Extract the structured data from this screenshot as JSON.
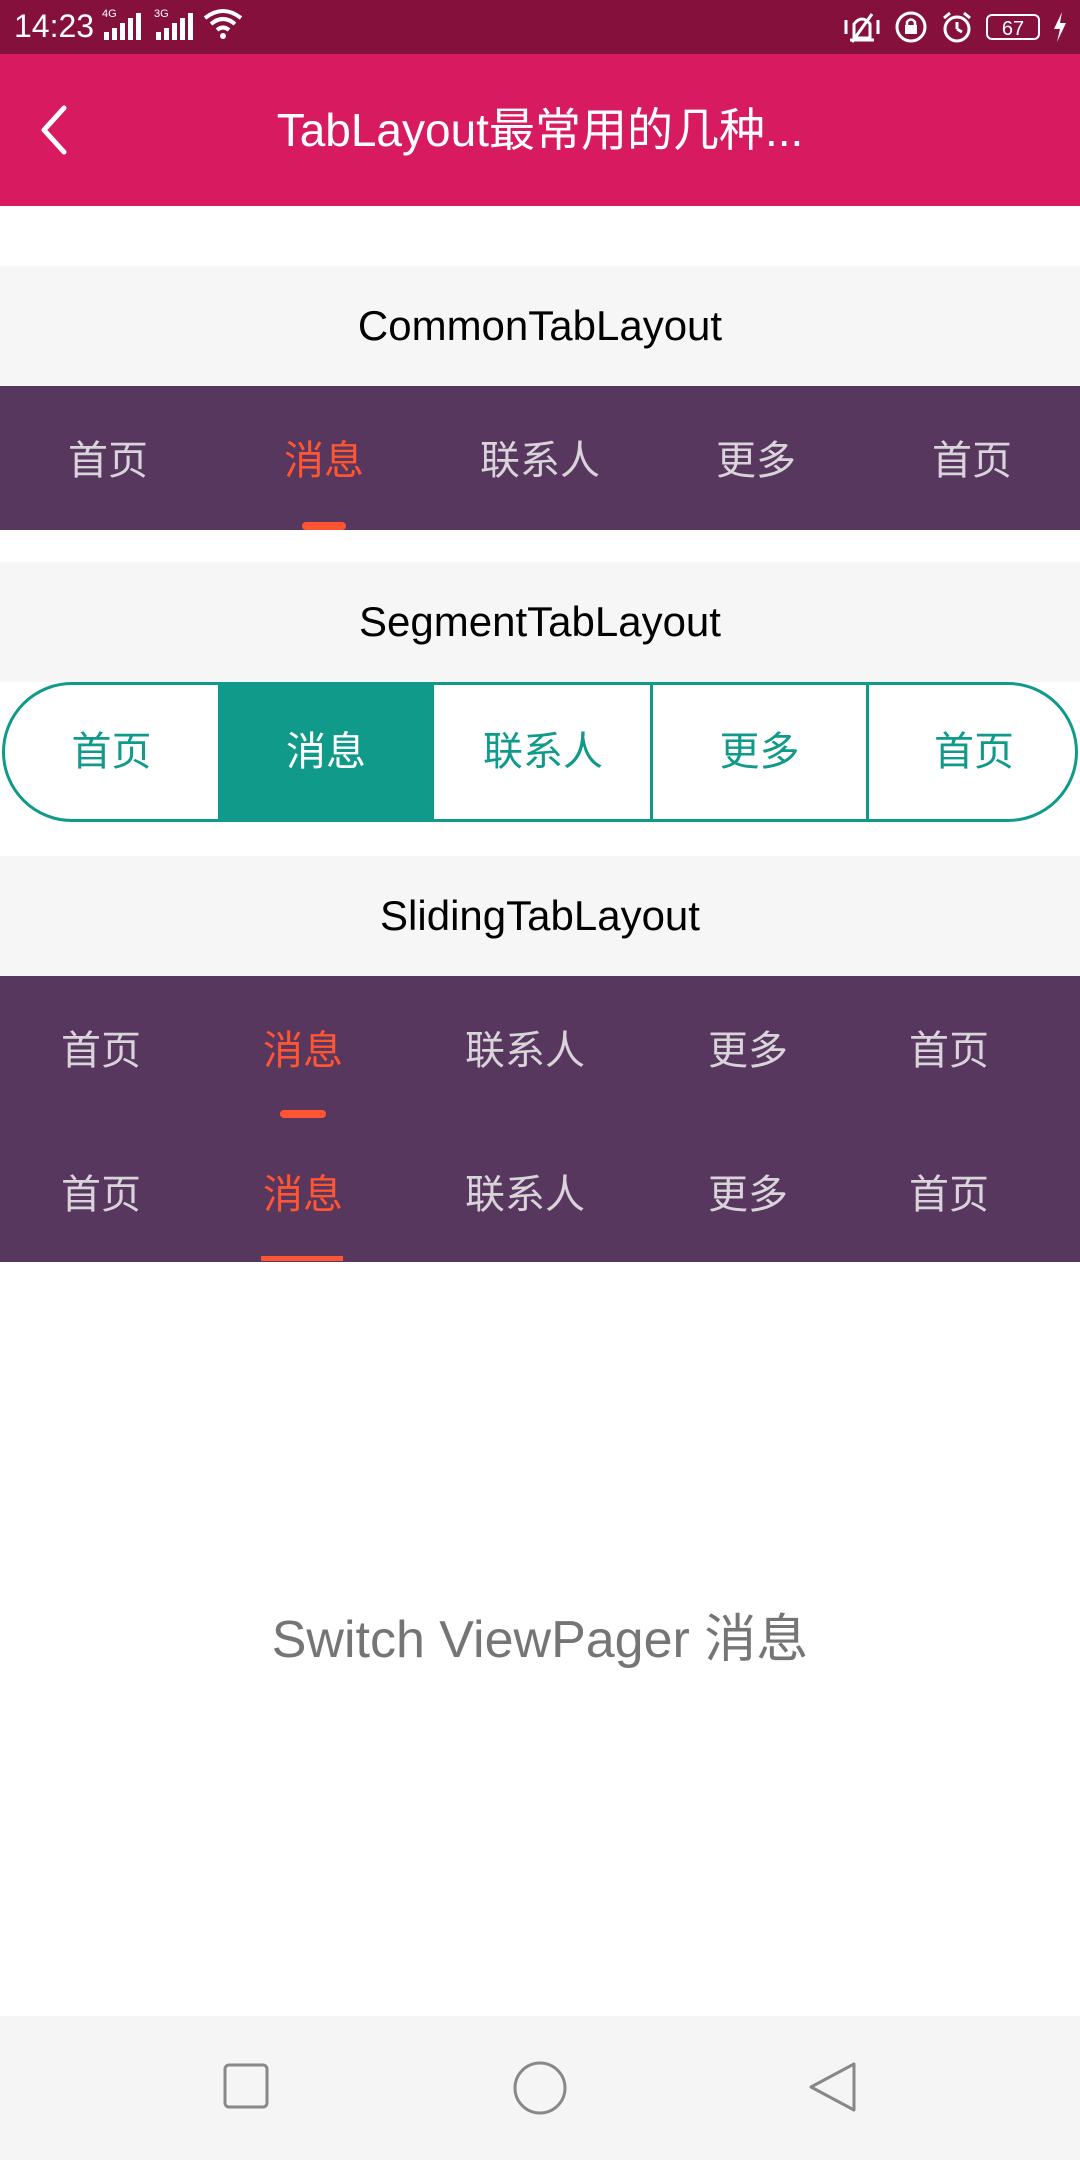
{
  "status_bar": {
    "time": "14:23",
    "network_1": "4G",
    "network_2": "3G",
    "battery": "67"
  },
  "app_bar": {
    "title": "TabLayout最常用的几种...",
    "background": "#d81b60"
  },
  "common_tab_layout": {
    "title": "CommonTabLayout",
    "tabs": [
      "首页",
      "消息",
      "联系人",
      "更多",
      "首页"
    ],
    "selected_index": 1
  },
  "segment_tab_layout": {
    "title": "SegmentTabLayout",
    "tabs": [
      "首页",
      "消息",
      "联系人",
      "更多",
      "首页"
    ],
    "selected_index": 1,
    "accent": "#0f9a8a"
  },
  "sliding_tab_layout": {
    "title": "SlidingTabLayout",
    "tabs": [
      "首页",
      "消息",
      "联系人",
      "更多",
      "首页"
    ],
    "selected_index": 1,
    "tabs_2": [
      "首页",
      "消息",
      "联系人",
      "更多",
      "首页"
    ],
    "selected_index_2": 1
  },
  "content": {
    "text": "Switch ViewPager 消息"
  },
  "colors": {
    "tab_bar": "#57375d",
    "selected_tab": "#ff5533",
    "status_bar": "#85103b"
  },
  "icons": {
    "back": "chevron-left-icon",
    "nav_recents": "square-icon",
    "nav_home": "circle-icon",
    "nav_back": "triangle-back-icon"
  }
}
